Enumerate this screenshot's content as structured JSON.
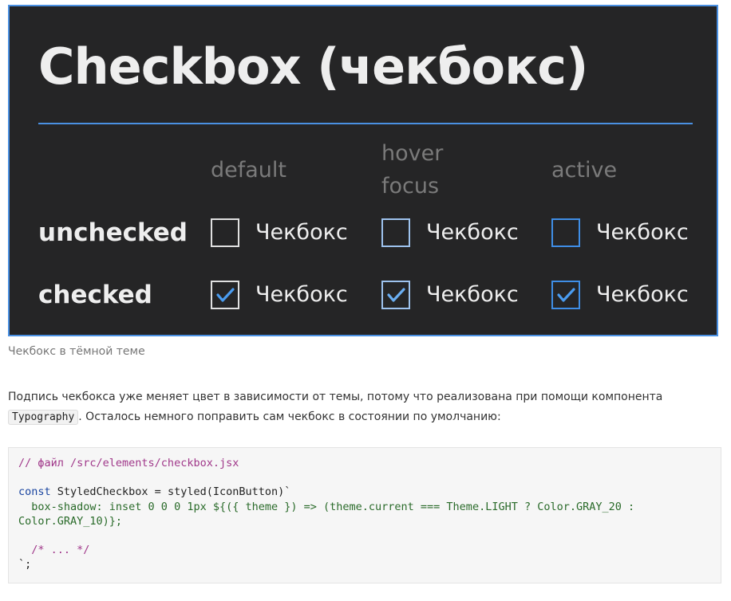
{
  "figure": {
    "title": "Checkbox (чекбокс)",
    "columns": [
      {
        "line1": "default",
        "line2": ""
      },
      {
        "line1": "hover",
        "line2": "focus"
      },
      {
        "line1": "active",
        "line2": ""
      }
    ],
    "rows": [
      "unchecked",
      "checked"
    ],
    "checkbox_label": "Чекбокс",
    "colors": {
      "background": "#252526",
      "border": "#4a90e2",
      "default_box": "#e0e0e0",
      "hover_box": "#9ec3ee",
      "active_box": "#3f8ee6"
    }
  },
  "caption": "Чекбокс в тёмной теме",
  "paragraph": {
    "before": "Подпись чекбокса уже меняет цвет в зависимости от темы, потому что реализована при помощи компонента ",
    "code": "Typography",
    "after": ". Осталось немного поправить сам чекбокс в состоянии по умолчанию:"
  },
  "code": {
    "line1": "// файл /src/elements/checkbox.jsx",
    "line2": "",
    "line3_kw": "const",
    "line3_rest": " StyledCheckbox = styled(IconButton)`",
    "line4": "  box-shadow: inset 0 0 0 1px ${({ theme }) => (theme.current === Theme.LIGHT ? Color.GRAY_20 :",
    "line5": "Color.GRAY_10)};",
    "line6": "",
    "line7": "  /* ... */",
    "line8": "`;"
  }
}
